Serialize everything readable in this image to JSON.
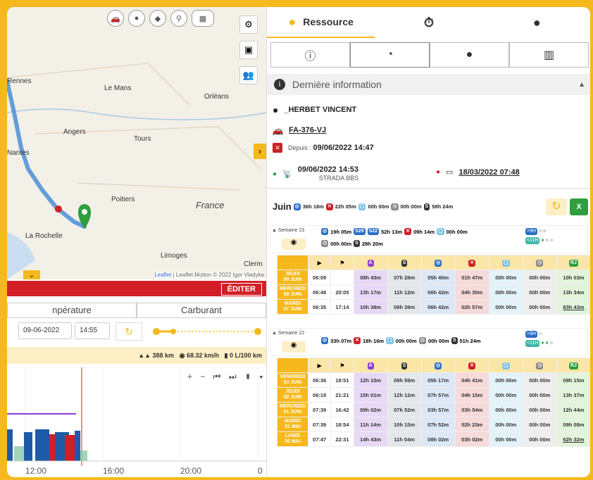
{
  "map": {
    "cities": [
      "Rennes",
      "Le Mans",
      "Orléans",
      "Angers",
      "Tours",
      "Nantes",
      "Poitiers",
      "France",
      "La Rochelle",
      "Limoges",
      "Clerm"
    ],
    "attribution_leaflet": "Leaflet",
    "attribution_rest": " | Leaflet.Motion © 2022 Igor Vladyka"
  },
  "left": {
    "edit_label": "ÉDITER",
    "tab_temperature": "npérature",
    "tab_fuel": "Carburant",
    "date": "09-06-2022",
    "time": "14:55",
    "distance": "388 km",
    "speed": "68.32 km/h",
    "consumption": "0 L/100 km",
    "x_ticks": [
      "12:00",
      "16:00",
      "20:00",
      "0"
    ]
  },
  "right": {
    "tab_resource": "Ressource",
    "section_title": "Dernière information",
    "driver": "_HERBET VINCENT",
    "plate": "FA-376-VJ",
    "since_label": "Depuis : ",
    "since_value": "09/06/2022 14:47",
    "gps_time": "09/06/2022 14:53",
    "gps_source": "STRADA BBS",
    "card_time": "18/03/2022 07:48",
    "month": "Juin",
    "month_stats": [
      "36h 18m",
      "22h 05m",
      "00h 00m",
      "00h 00m",
      "58h 24m"
    ],
    "w23": {
      "label": "Semaine 23",
      "stats": [
        "19h 05m",
        "52h 13m",
        "09h 14m",
        "00h 00m",
        "00h 00m",
        "28h 20m"
      ],
      "badge1": ">9H",
      "badge2": "<11H"
    },
    "w22": {
      "label": "Semaine 22",
      "stats": [
        "33h 07m",
        "18h 16m",
        "00h 00m",
        "00h 00m",
        "51h 24m"
      ],
      "badge1": ">9H",
      "badge2": "<11H"
    },
    "rows23": [
      [
        "JEUDI",
        "09 JUIN",
        "06:09",
        "",
        "08h 43m",
        "07h 28m",
        "05h 40m",
        "01h 47m",
        "00h 00m",
        "00h 00m",
        "10h 03m"
      ],
      [
        "MERCREDI",
        "08 JUIN",
        "06:48",
        "20:05",
        "13h 17m",
        "11h 12m",
        "06h 42m",
        "04h 30m",
        "00h 00m",
        "00h 00m",
        "13h 34m"
      ],
      [
        "MARDI",
        "07 JUIN",
        "06:35",
        "17:14",
        "10h 38m",
        "09h 39m",
        "06h 42m",
        "02h 57m",
        "00h 00m",
        "00h 00m",
        "83h 43m"
      ]
    ],
    "rows22": [
      [
        "VENDREDI",
        "03 JUIN",
        "06:36",
        "18:51",
        "12h 15m",
        "09h 59m",
        "05h 17m",
        "04h 41m",
        "00h 00m",
        "00h 00m",
        "09h 15m"
      ],
      [
        "JEUDI",
        "02 JUIN",
        "06:19",
        "21:21",
        "15h 01m",
        "12h 12m",
        "07h 57m",
        "04h 15m",
        "00h 00m",
        "00h 00m",
        "13h 37m"
      ],
      [
        "MERCREDI",
        "01 JUIN",
        "07:39",
        "16:42",
        "09h 02m",
        "07h 52m",
        "03h 57m",
        "03h 54m",
        "00h 00m",
        "00h 00m",
        "12h 44m"
      ],
      [
        "MARDI",
        "31 MAI",
        "07:39",
        "18:54",
        "11h 14m",
        "10h 15m",
        "07h 52m",
        "02h 23m",
        "00h 00m",
        "00h 00m",
        "09h 08m"
      ],
      [
        "LUNDI",
        "30 MAI",
        "07:47",
        "22:31",
        "14h 43m",
        "11h 04m",
        "08h 02m",
        "03h 02m",
        "00h 00m",
        "00h 00m",
        "62h 32m"
      ]
    ],
    "col_letters": [
      "A",
      "S",
      "R",
      "RJ"
    ]
  },
  "colors": {
    "accent": "#F6B91D",
    "red": "#D21F27",
    "route": "#4a8fd6",
    "green": "#2e9e3e"
  }
}
